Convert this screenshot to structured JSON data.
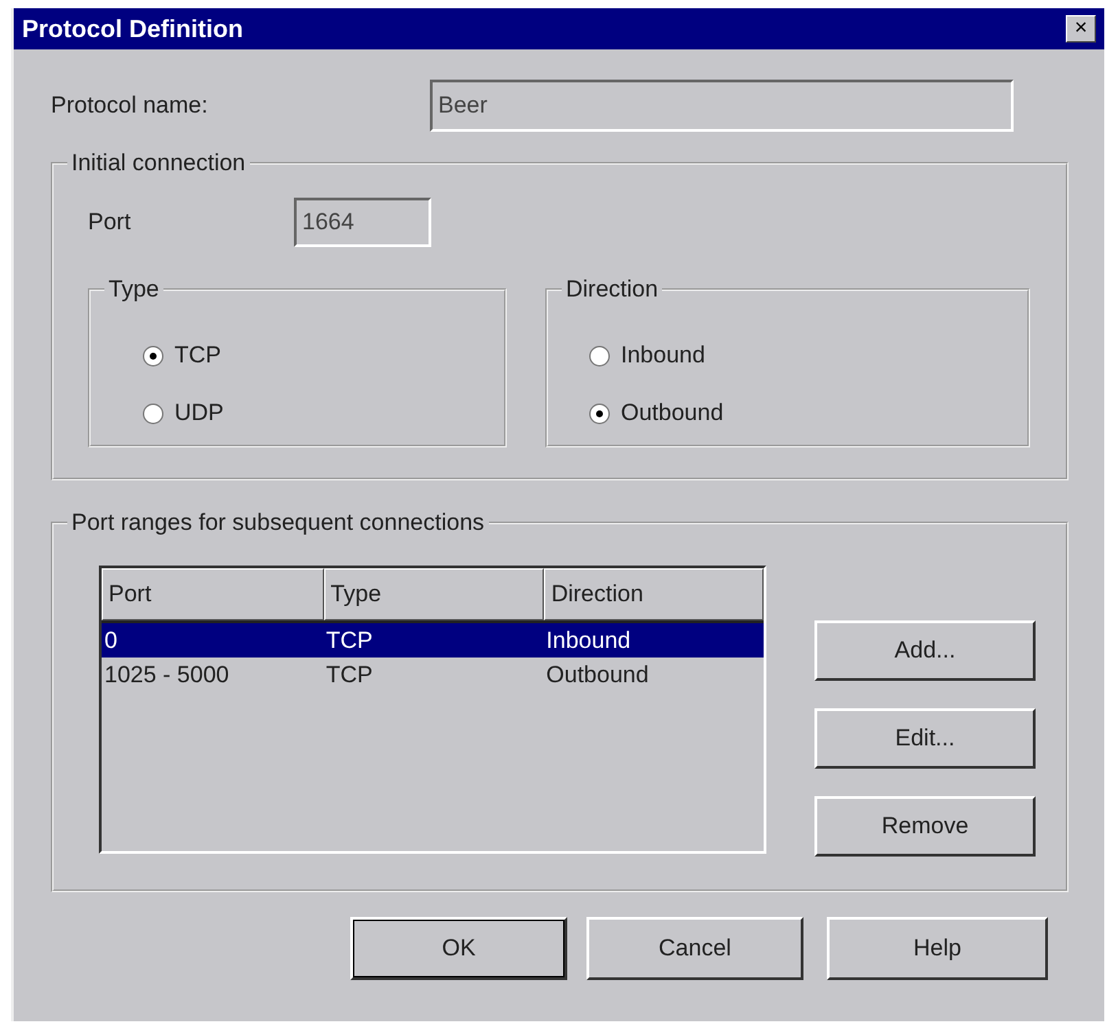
{
  "window": {
    "title": "Protocol Definition",
    "close": "×"
  },
  "protocol_name": {
    "label": "Protocol name:",
    "value": "Beer"
  },
  "initial_connection": {
    "title": "Initial connection",
    "port_label": "Port",
    "port_value": "1664",
    "type": {
      "title": "Type",
      "options": [
        {
          "label": "TCP",
          "selected": true
        },
        {
          "label": "UDP",
          "selected": false
        }
      ]
    },
    "direction": {
      "title": "Direction",
      "options": [
        {
          "label": "Inbound",
          "selected": false
        },
        {
          "label": "Outbound",
          "selected": true
        }
      ]
    }
  },
  "port_ranges": {
    "title": "Port ranges for subsequent connections",
    "table": {
      "columns": [
        "Port",
        "Type",
        "Direction"
      ],
      "rows": [
        {
          "cells": [
            "0",
            "TCP",
            "Inbound"
          ],
          "selected": true
        },
        {
          "cells": [
            "1025 - 5000",
            "TCP",
            "Outbound"
          ],
          "selected": false
        }
      ]
    },
    "buttons": [
      "Add...",
      "Edit...",
      "Remove"
    ]
  },
  "buttons": [
    {
      "label": "OK",
      "default": true
    },
    {
      "label": "Cancel",
      "default": false
    },
    {
      "label": "Help",
      "default": false
    }
  ]
}
